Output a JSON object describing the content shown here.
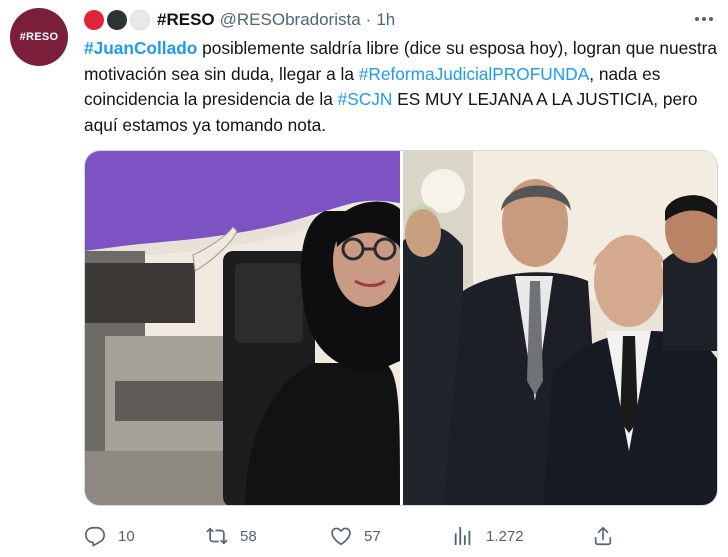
{
  "avatar": {
    "label": "#RESO"
  },
  "user": {
    "name": "#RESO",
    "handle": "@RESObradorista",
    "separator": "·",
    "time": "1h"
  },
  "tweet": {
    "tag1": "#JuanCollado",
    "t1": " posiblemente saldría libre (dice su esposa hoy), logran que nuestra motivación sea sin duda, llegar a la ",
    "tag2": "#ReformaJudicialPROFUNDA",
    "t2": ", nada es coincidencia la presidencia de la ",
    "tag3": "#SCJN",
    "t3": " ES MUY LEJANA A LA JUSTICIA, pero aquí estamos ya tomando nota."
  },
  "actions": {
    "replies": "10",
    "retweets": "58",
    "likes": "57",
    "views": "1.272"
  },
  "colors": {
    "accent": "#1d9bf0",
    "avatar_bg": "#7b1e3a",
    "purple_bg": "#7d52c2",
    "muted": "#536471"
  },
  "icons": [
    "more-icon",
    "reply-icon",
    "retweet-icon",
    "like-icon",
    "views-icon",
    "share-icon"
  ]
}
